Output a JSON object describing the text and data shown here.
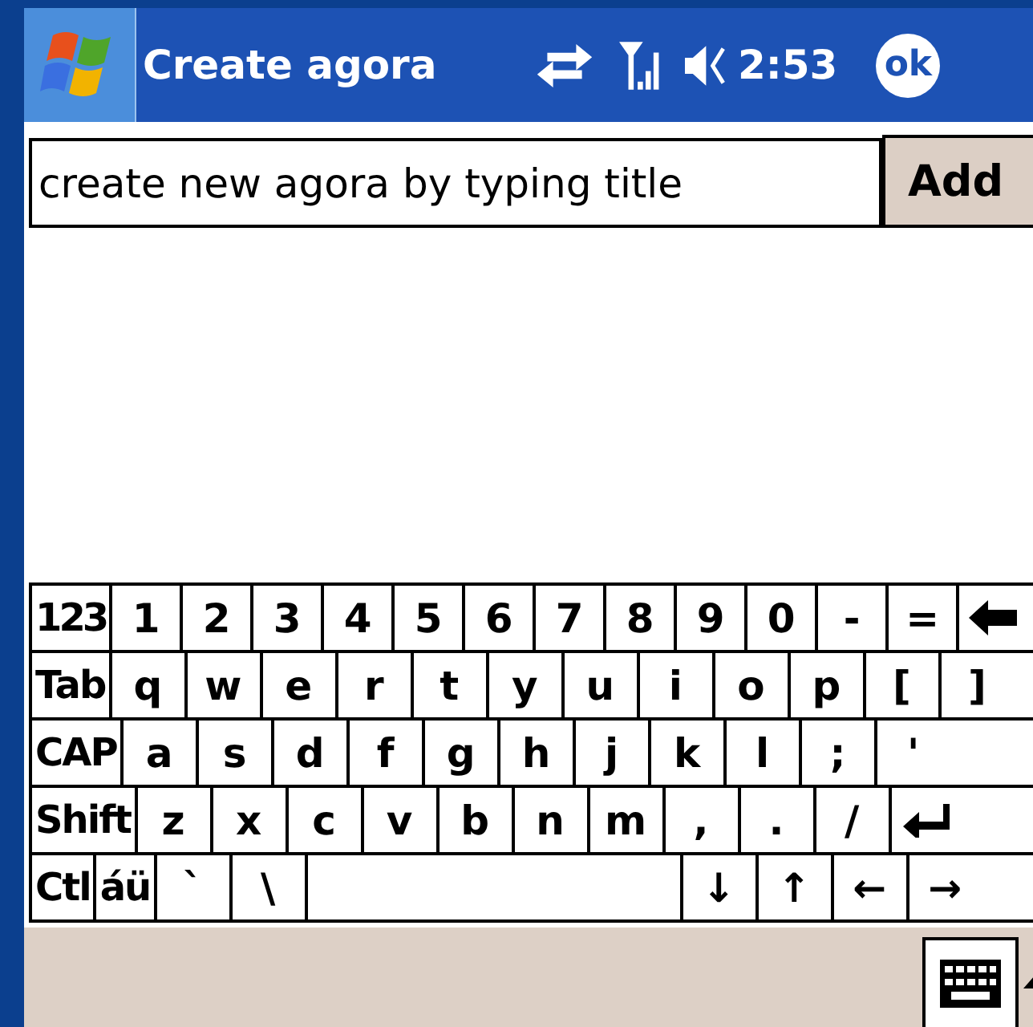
{
  "title_bar": {
    "title": "Create agora",
    "time": "2:53",
    "ok": "ok"
  },
  "create_form": {
    "value": "create new agora by typing title",
    "button": "Add"
  },
  "keyboard": {
    "rows": [
      [
        {
          "label": "123",
          "kind": "mod"
        },
        {
          "label": "1",
          "kind": "char"
        },
        {
          "label": "2",
          "kind": "char"
        },
        {
          "label": "3",
          "kind": "char"
        },
        {
          "label": "4",
          "kind": "char"
        },
        {
          "label": "5",
          "kind": "char"
        },
        {
          "label": "6",
          "kind": "char"
        },
        {
          "label": "7",
          "kind": "char"
        },
        {
          "label": "8",
          "kind": "char"
        },
        {
          "label": "9",
          "kind": "char"
        },
        {
          "label": "0",
          "kind": "char"
        },
        {
          "label": "-",
          "kind": "char"
        },
        {
          "label": "=",
          "kind": "char"
        },
        {
          "kind": "backspace"
        }
      ],
      [
        {
          "label": "Tab",
          "kind": "mod"
        },
        {
          "label": "q",
          "kind": "char"
        },
        {
          "label": "w",
          "kind": "char"
        },
        {
          "label": "e",
          "kind": "char"
        },
        {
          "label": "r",
          "kind": "char"
        },
        {
          "label": "t",
          "kind": "char"
        },
        {
          "label": "y",
          "kind": "char"
        },
        {
          "label": "u",
          "kind": "char"
        },
        {
          "label": "i",
          "kind": "char"
        },
        {
          "label": "o",
          "kind": "char"
        },
        {
          "label": "p",
          "kind": "char"
        },
        {
          "label": "[",
          "kind": "char"
        },
        {
          "label": "]",
          "kind": "char"
        }
      ],
      [
        {
          "label": "CAP",
          "kind": "mod"
        },
        {
          "label": "a",
          "kind": "char"
        },
        {
          "label": "s",
          "kind": "char"
        },
        {
          "label": "d",
          "kind": "char"
        },
        {
          "label": "f",
          "kind": "char"
        },
        {
          "label": "g",
          "kind": "char"
        },
        {
          "label": "h",
          "kind": "char"
        },
        {
          "label": "j",
          "kind": "char"
        },
        {
          "label": "k",
          "kind": "char"
        },
        {
          "label": "l",
          "kind": "char"
        },
        {
          "label": ";",
          "kind": "char"
        },
        {
          "label": "'",
          "kind": "char"
        }
      ],
      [
        {
          "label": "Shift",
          "kind": "mod"
        },
        {
          "label": "z",
          "kind": "char"
        },
        {
          "label": "x",
          "kind": "char"
        },
        {
          "label": "c",
          "kind": "char"
        },
        {
          "label": "v",
          "kind": "char"
        },
        {
          "label": "b",
          "kind": "char"
        },
        {
          "label": "n",
          "kind": "char"
        },
        {
          "label": "m",
          "kind": "char"
        },
        {
          "label": ",",
          "kind": "char"
        },
        {
          "label": ".",
          "kind": "char"
        },
        {
          "label": "/",
          "kind": "char"
        },
        {
          "kind": "enter"
        }
      ],
      [
        {
          "label": "Ctl",
          "kind": "mod"
        },
        {
          "label": "áü",
          "kind": "mod"
        },
        {
          "label": "`",
          "kind": "char"
        },
        {
          "label": "\\",
          "kind": "char"
        },
        {
          "kind": "space"
        },
        {
          "label": "↓",
          "kind": "char"
        },
        {
          "label": "↑",
          "kind": "char"
        },
        {
          "label": "←",
          "kind": "char"
        },
        {
          "label": "→",
          "kind": "char"
        }
      ]
    ]
  }
}
